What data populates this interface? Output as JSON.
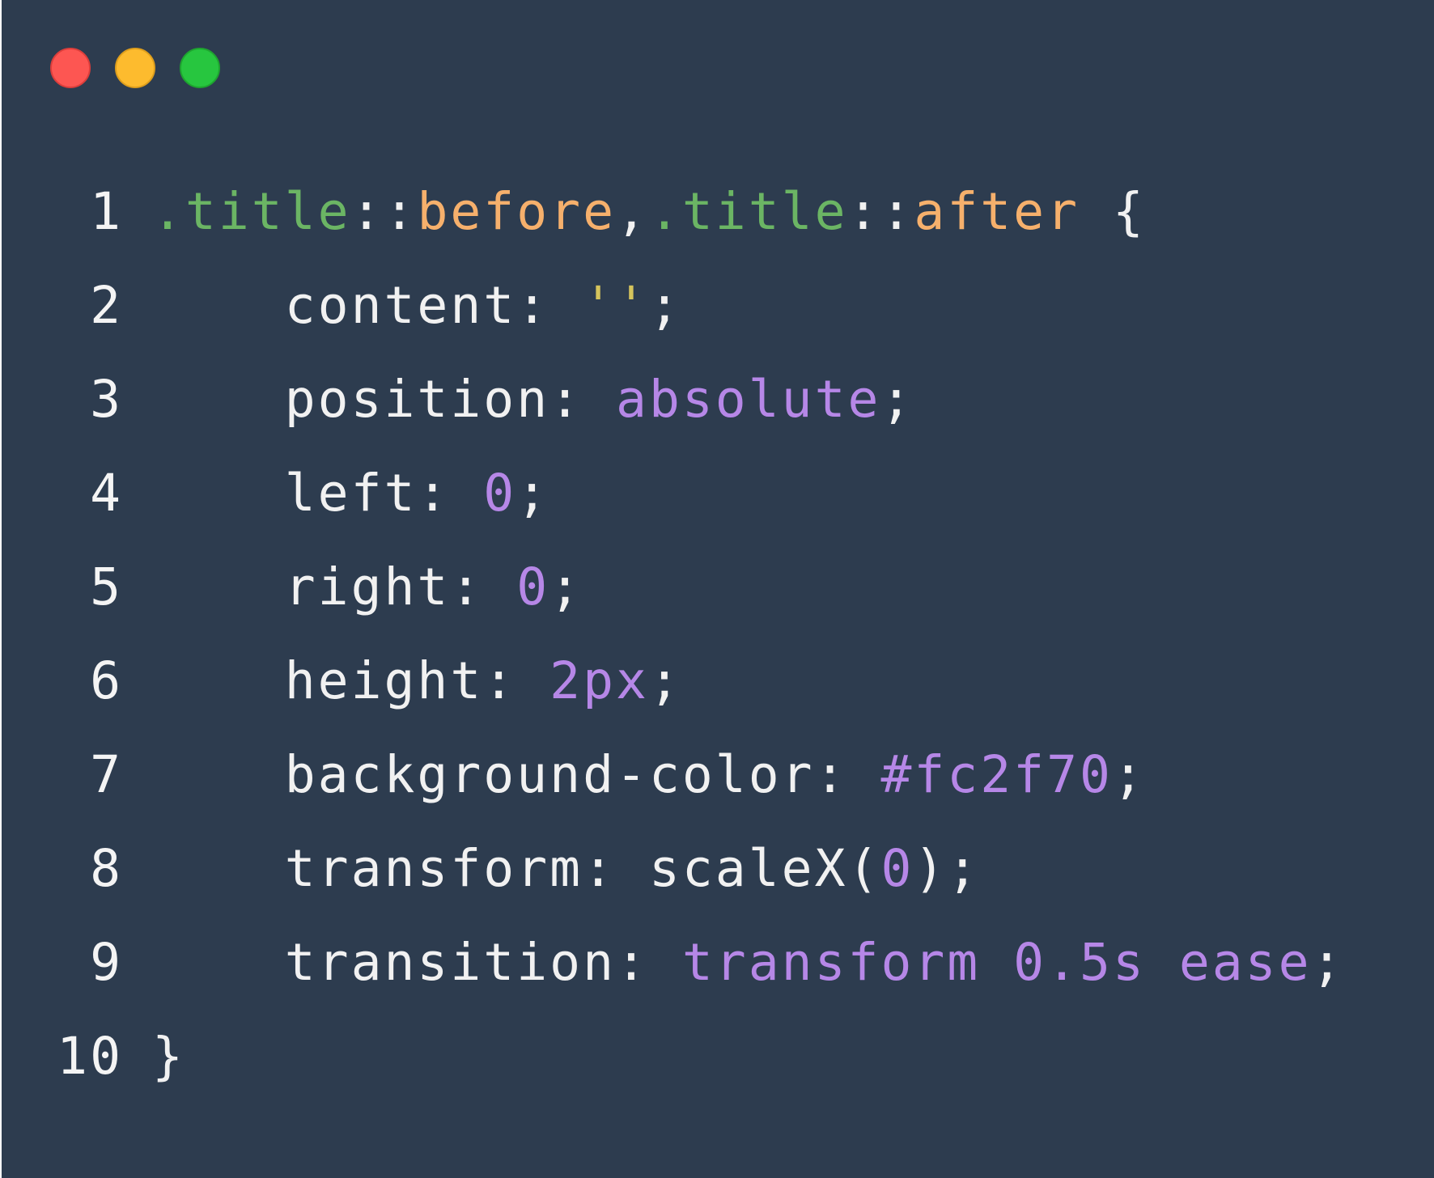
{
  "window": {
    "background": "#2d3c4f",
    "controls": [
      {
        "name": "close",
        "color": "#fd5652",
        "border": "#dd3e3b"
      },
      {
        "name": "minimize",
        "color": "#fdbb2e",
        "border": "#de9e1c"
      },
      {
        "name": "maximize",
        "color": "#27c63f",
        "border": "#1ea52f"
      }
    ]
  },
  "colors": {
    "plain": "#f1f1f1",
    "selector": "#6bb564",
    "pseudo": "#f6b06c",
    "string": "#d5c45c",
    "value": "#b687e7"
  },
  "code": {
    "lines": [
      {
        "number": "1",
        "tokens": [
          {
            "text": ".title",
            "kind": "selector"
          },
          {
            "text": "::",
            "kind": "plain"
          },
          {
            "text": "before",
            "kind": "pseudo"
          },
          {
            "text": ",",
            "kind": "plain"
          },
          {
            "text": ".title",
            "kind": "selector"
          },
          {
            "text": "::",
            "kind": "plain"
          },
          {
            "text": "after",
            "kind": "pseudo"
          },
          {
            "text": " {",
            "kind": "plain"
          }
        ]
      },
      {
        "number": "2",
        "tokens": [
          {
            "text": "    content: ",
            "kind": "plain"
          },
          {
            "text": "''",
            "kind": "string"
          },
          {
            "text": ";",
            "kind": "plain"
          }
        ]
      },
      {
        "number": "3",
        "tokens": [
          {
            "text": "    position: ",
            "kind": "plain"
          },
          {
            "text": "absolute",
            "kind": "value"
          },
          {
            "text": ";",
            "kind": "plain"
          }
        ]
      },
      {
        "number": "4",
        "tokens": [
          {
            "text": "    left: ",
            "kind": "plain"
          },
          {
            "text": "0",
            "kind": "value"
          },
          {
            "text": ";",
            "kind": "plain"
          }
        ]
      },
      {
        "number": "5",
        "tokens": [
          {
            "text": "    right: ",
            "kind": "plain"
          },
          {
            "text": "0",
            "kind": "value"
          },
          {
            "text": ";",
            "kind": "plain"
          }
        ]
      },
      {
        "number": "6",
        "tokens": [
          {
            "text": "    height: ",
            "kind": "plain"
          },
          {
            "text": "2px",
            "kind": "value"
          },
          {
            "text": ";",
            "kind": "plain"
          }
        ]
      },
      {
        "number": "7",
        "tokens": [
          {
            "text": "    background-color: ",
            "kind": "plain"
          },
          {
            "text": "#fc2f70",
            "kind": "value"
          },
          {
            "text": ";",
            "kind": "plain"
          }
        ]
      },
      {
        "number": "8",
        "tokens": [
          {
            "text": "    transform: scaleX(",
            "kind": "plain"
          },
          {
            "text": "0",
            "kind": "value"
          },
          {
            "text": ");",
            "kind": "plain"
          }
        ]
      },
      {
        "number": "9",
        "tokens": [
          {
            "text": "    transition: ",
            "kind": "plain"
          },
          {
            "text": "transform 0.5s ease",
            "kind": "value"
          },
          {
            "text": ";",
            "kind": "plain"
          }
        ]
      },
      {
        "number": "10",
        "tokens": [
          {
            "text": "}",
            "kind": "plain"
          }
        ]
      }
    ]
  }
}
